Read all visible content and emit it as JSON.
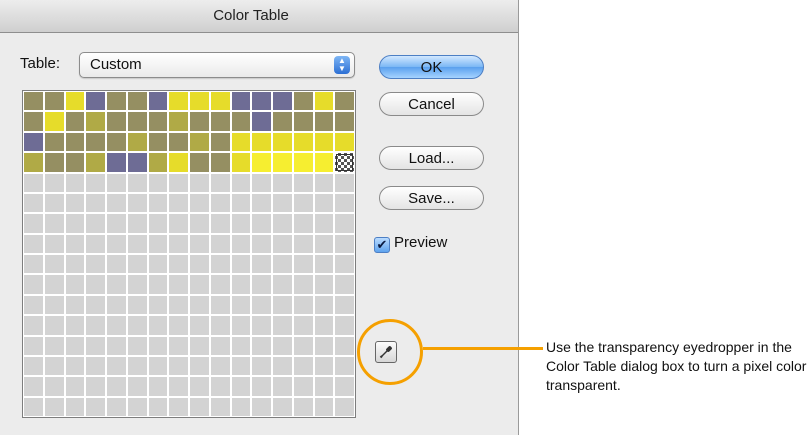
{
  "dialog": {
    "title": "Color Table"
  },
  "table": {
    "label": "Table:",
    "selected": "Custom"
  },
  "buttons": {
    "ok": "OK",
    "cancel": "Cancel",
    "load": "Load...",
    "save": "Save..."
  },
  "preview": {
    "label": "Preview",
    "checked": true
  },
  "eyedropper": {
    "icon": "transparency-eyedropper-icon"
  },
  "callout": {
    "text": "Use the transparency eyedropper in the Color Table dialog box to turn a pixel color transparent."
  },
  "colors": {
    "accent": "#f5a000",
    "olive": "#958f62",
    "yellow": "#e6dc2a",
    "purple": "#6e6c95",
    "brightYellow": "#f6ee30",
    "khaki": "#b0aa46"
  },
  "swatches": [
    "olive",
    "olive",
    "yellow",
    "purple",
    "olive",
    "olive",
    "purple",
    "yellow",
    "yellow",
    "yellow",
    "purple",
    "purple",
    "purple",
    "olive",
    "yellow",
    "olive",
    "olive",
    "yellow",
    "olive",
    "khaki",
    "olive",
    "olive",
    "olive",
    "khaki",
    "olive",
    "olive",
    "olive",
    "purple",
    "olive",
    "olive",
    "olive",
    "olive",
    "purple",
    "olive",
    "olive",
    "olive",
    "olive",
    "khaki",
    "olive",
    "olive",
    "khaki",
    "olive",
    "yellow",
    "yellow",
    "yellow",
    "yellow",
    "yellow",
    "yellow",
    "khaki",
    "olive",
    "olive",
    "khaki",
    "purple",
    "purple",
    "khaki",
    "yellow",
    "olive",
    "olive",
    "yellow",
    "brightYellow",
    "brightYellow",
    "brightYellow",
    "brightYellow",
    "transparent"
  ],
  "total_cells": 256
}
